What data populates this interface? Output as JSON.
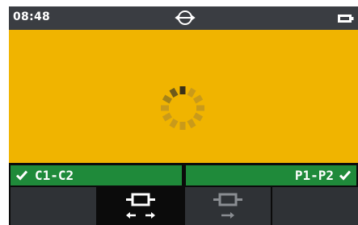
{
  "status_bar": {
    "time": "08:48",
    "mode_icon": "loopback-icon",
    "battery_icon": "battery-icon"
  },
  "main": {
    "state_icon": "loading-spinner-icon",
    "background_color": "#f0b400"
  },
  "results": {
    "left_label": "C1-C2",
    "left_status_icon": "check-icon",
    "right_label": "P1-P2",
    "right_status_icon": "check-icon",
    "pass_color": "#1f8a3a"
  },
  "softkeys": [
    {
      "icon": "",
      "selected": false
    },
    {
      "icon": "bidirectional-link-icon",
      "selected": true
    },
    {
      "icon": "unidirectional-link-icon",
      "selected": false
    },
    {
      "icon": "",
      "selected": false
    }
  ]
}
